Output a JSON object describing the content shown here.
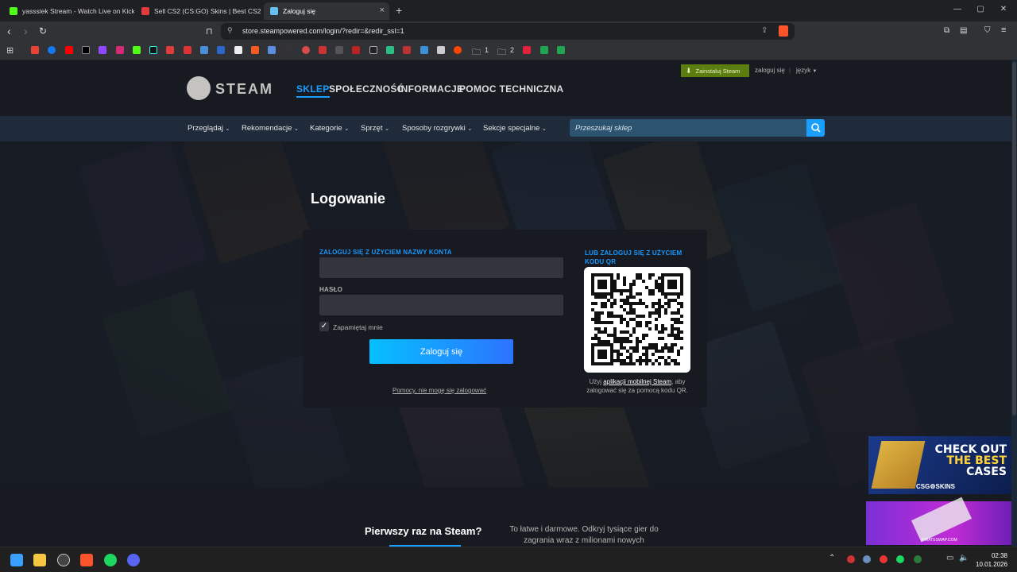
{
  "browser": {
    "tabs": [
      {
        "title": "yasssiek Stream - Watch Live on Kick",
        "color": "#53fc18",
        "active": false
      },
      {
        "title": "Sell CS2 (CS:GO) Skins | Best CS2 (CS",
        "color": "#e23b3b",
        "active": false
      },
      {
        "title": "Zaloguj się",
        "color": "#66c0f4",
        "active": true
      }
    ],
    "url": "store.steampowered.com/login/?redir=&redir_ssl=1",
    "bookmark_folders": [
      "1",
      "2"
    ]
  },
  "steam": {
    "logo_text": "STEAM",
    "top_nav": [
      "SKLEP",
      "SPOŁECZNOŚĆ",
      "INFORMACJE",
      "POMOC TECHNICZNA"
    ],
    "install_label": "Zainstaluj Steam",
    "login_link": "zaloguj się",
    "language_link": "język",
    "store_nav": [
      "Przeglądaj",
      "Rekomendacje",
      "Kategorie",
      "Sprzęt",
      "Sposoby rozgrywki",
      "Sekcje specjalne"
    ],
    "search_placeholder": "Przeszukaj sklep"
  },
  "login": {
    "title": "Logowanie",
    "account_label": "ZALOGUJ SIĘ Z UŻYCIEM NAZWY KONTA",
    "password_label": "HASŁO",
    "remember_label": "Zapamiętaj mnie",
    "submit_label": "Zaloguj się",
    "help_link": "Pomocy, nie mogę się zalogować",
    "qr_label": "LUB ZALOGUJ SIĘ Z UŻYCIEM KODU QR",
    "qr_caption_pre": "Użyj ",
    "qr_caption_link": "aplikacji mobilnej Steam",
    "qr_caption_post": ", aby zalogować się za pomocą kodu QR."
  },
  "footer": {
    "first_time": "Pierwszy raz na Steam?",
    "free_text": "To łatwe i darmowe. Odkryj tysiące gier do zagrania wraz z milionami nowych"
  },
  "ads": {
    "ad1_line1": "CHECK OUT",
    "ad1_line2": "THE BEST",
    "ad1_line3": "CASES",
    "ad1_brand": "CSG⚙SKINS",
    "ad2_brand": "PIRATESWAP.COM"
  },
  "taskbar": {
    "time": "02:38",
    "date": "10.01.2026"
  }
}
